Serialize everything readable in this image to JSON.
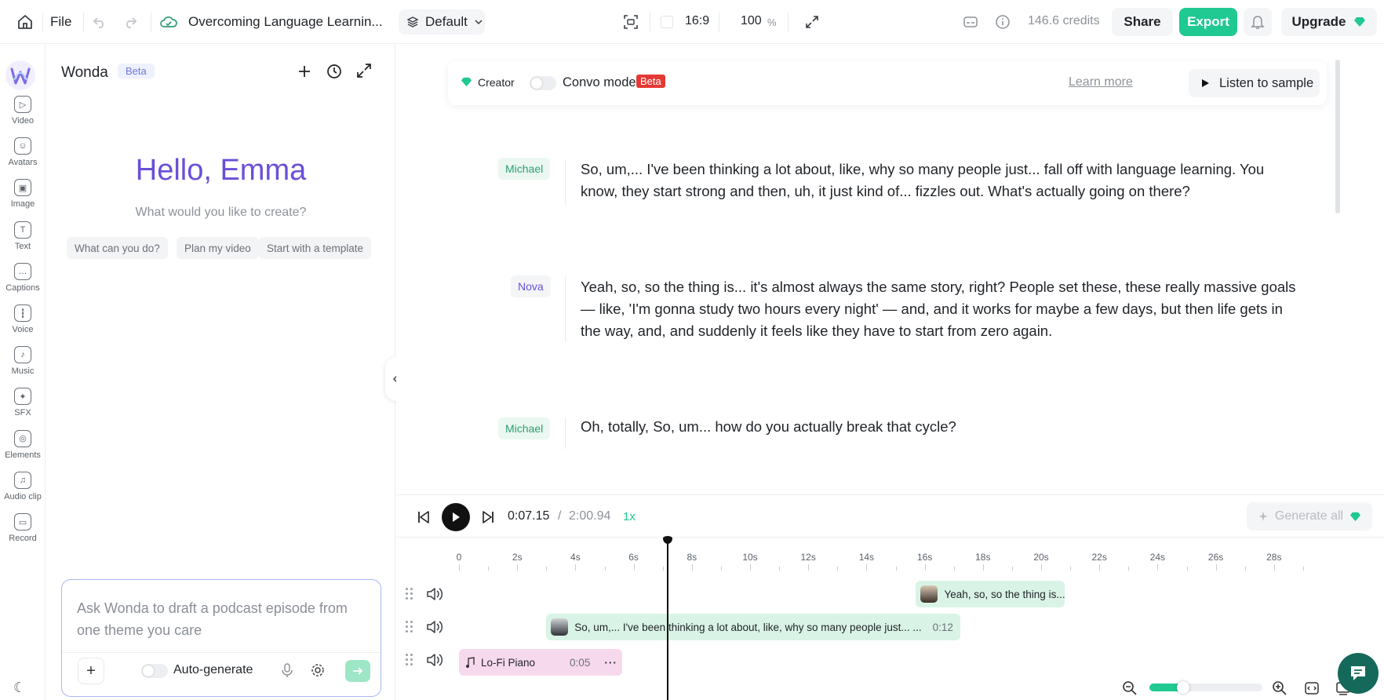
{
  "topbar": {
    "file_label": "File",
    "project_title": "Overcoming Language Learnin...",
    "style_label": "Default",
    "aspect_ratio": "16:9",
    "zoom_value": "100",
    "zoom_unit": "%",
    "credits": "146.6 credits",
    "share_label": "Share",
    "export_label": "Export",
    "upgrade_label": "Upgrade",
    "accent_color": "#1fc991"
  },
  "rail": {
    "items": [
      {
        "label": "Video",
        "icon": "video-icon"
      },
      {
        "label": "Avatars",
        "icon": "avatar-icon"
      },
      {
        "label": "Image",
        "icon": "image-icon"
      },
      {
        "label": "Text",
        "icon": "text-icon"
      },
      {
        "label": "Captions",
        "icon": "captions-icon"
      },
      {
        "label": "Voice",
        "icon": "voice-icon"
      },
      {
        "label": "Music",
        "icon": "music-icon"
      },
      {
        "label": "SFX",
        "icon": "sfx-icon"
      },
      {
        "label": "Elements",
        "icon": "elements-icon"
      },
      {
        "label": "Audio clip",
        "icon": "audio-clip-icon"
      },
      {
        "label": "Record",
        "icon": "record-icon"
      }
    ]
  },
  "wonda": {
    "title": "Wonda",
    "badge": "Beta",
    "greeting": "Hello, Emma",
    "subtitle": "What would you like to create?",
    "chips": [
      "What can you do?",
      "Plan my video",
      "Start with a template"
    ],
    "prompt_placeholder": "Ask Wonda to draft a podcast episode from one theme you care",
    "auto_generate_label": "Auto-generate"
  },
  "script": {
    "creator_label": "Creator",
    "convo_mode_label": "Convo mode",
    "beta_label": "Beta",
    "learn_more_label": "Learn more",
    "listen_label": "Listen to sample",
    "lines": [
      {
        "speaker": "Michael",
        "text": "So, um,... I've been thinking a lot about, like, why so many people just... fall off with language learning. You know, they start strong and then, uh, it just kind of... fizzles out. What's actually going on there?"
      },
      {
        "speaker": "Nova",
        "text": "Yeah, so, so the thing is... it's almost always the same story, right? People set these, these really massive goals — like, 'I'm gonna study two hours every night' — and, and it works for maybe a few days, but then life gets in the way, and, and suddenly it feels like they have to start from zero again."
      },
      {
        "speaker": "Michael",
        "text": "Oh, totally, So, um... how do you actually break that cycle?"
      }
    ]
  },
  "player": {
    "current_time": "0:07.15",
    "separator": "/",
    "total_time": "2:00.94",
    "speed": "1x",
    "generate_all_label": "Generate all",
    "ticks": [
      "0",
      "2s",
      "4s",
      "6s",
      "8s",
      "10s",
      "12s",
      "14s",
      "16s",
      "18s",
      "20s",
      "22s",
      "24s",
      "26s",
      "28s"
    ],
    "playhead_seconds": 7.15,
    "zoom_fraction": 0.3
  },
  "tracks": [
    {
      "type": "voice",
      "label": "Yeah, so, so the thing is... it's almost always the same story, right? People set these, these really massive goals — like, 'I'm gonna study two hours every night'",
      "duration": "",
      "start_seconds": 15.7
    },
    {
      "type": "voice",
      "label": "So, um,... I've been thinking a lot about, like, why so many people just... ...",
      "duration": "0:12",
      "start_seconds": 3.0
    },
    {
      "type": "music",
      "label": "Lo-Fi Piano",
      "duration": "0:05",
      "start_seconds": 0
    }
  ]
}
